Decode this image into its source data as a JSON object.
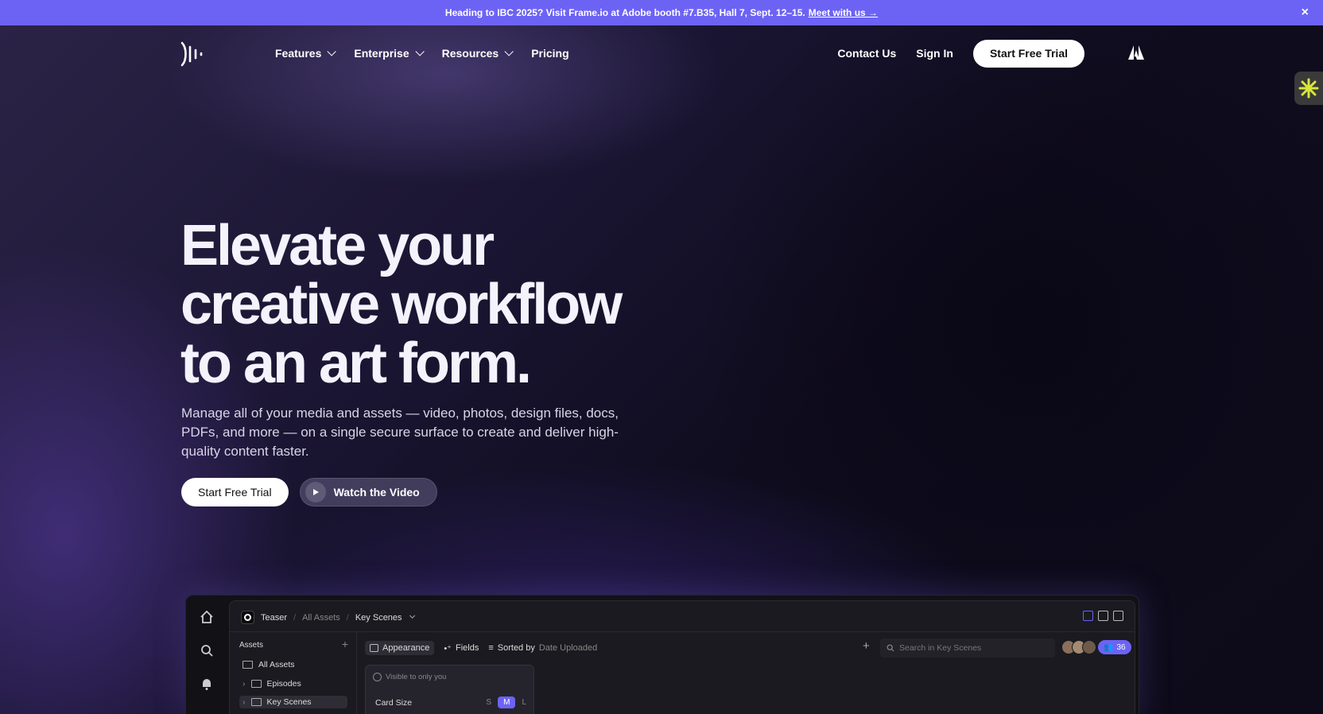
{
  "banner": {
    "text": "Heading to IBC 2025? Visit Frame.io at Adobe booth #7.B35, Hall 7, Sept. 12–15.",
    "link": "Meet with us →",
    "close": "×"
  },
  "nav": {
    "items": [
      {
        "label": "Features"
      },
      {
        "label": "Enterprise"
      },
      {
        "label": "Resources"
      },
      {
        "label": "Pricing"
      }
    ],
    "contact": "Contact Us",
    "sign_in": "Sign In",
    "cta": "Start Free Trial"
  },
  "hero": {
    "title_line1": "Elevate your",
    "title_line2": "creative workflow",
    "title_line3": "to an art form.",
    "subtitle": "Manage all of your media and assets — video, photos, design files, docs, PDFs, and more — on a single secure surface to create and deliver high-quality content faster.",
    "primary_cta": "Start Free Trial",
    "secondary_cta": "Watch the Video"
  },
  "app": {
    "breadcrumb": [
      "Teaser",
      "All Assets",
      "Key Scenes"
    ],
    "assets_label": "Assets",
    "tree": [
      "All Assets",
      "Episodes",
      "Key Scenes"
    ],
    "toolbar": {
      "appearance": "Appearance",
      "fields": "Fields",
      "sorted_by": "Sorted by",
      "sort_value": "Date Uploaded"
    },
    "search_placeholder": "Search in Key Scenes",
    "member_count": "36",
    "popover": {
      "note": "Visible to only you",
      "card_size_label": "Card Size",
      "sizes": [
        "S",
        "M",
        "L"
      ],
      "selected_size": "M"
    }
  },
  "colors": {
    "banner": "#6c63f5",
    "accent": "#6c63f5",
    "background": "#0c0a1a"
  }
}
